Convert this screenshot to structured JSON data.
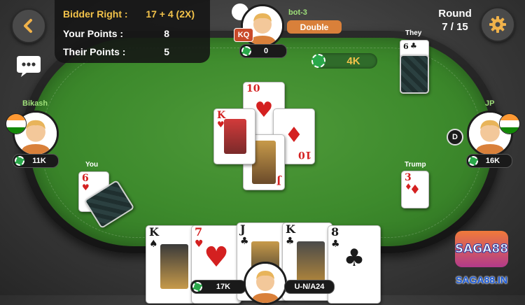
{
  "score": {
    "bidder_label": "Bidder Right :",
    "bidder_value": "17 + 4 (2X)",
    "your_label": "Your Points :",
    "your_value": "8",
    "their_label": "Their Points :",
    "their_value": "5"
  },
  "round": {
    "label": "Round",
    "value": "7 / 15"
  },
  "top_player": {
    "name": "bot-3",
    "badge": "KQ",
    "action": "Double",
    "coins": "0"
  },
  "pot": {
    "value": "4K"
  },
  "left_player": {
    "name": "Bikash",
    "coins": "11K"
  },
  "right_player": {
    "name": "JP",
    "coins": "16K",
    "dealer": "D"
  },
  "me": {
    "label": "You",
    "coins": "17K",
    "id": "U-N/A24"
  },
  "labels": {
    "they": "They",
    "trump": "Trump"
  },
  "center_cards": [
    {
      "rank": "10",
      "suit": "♥",
      "color": "red"
    },
    {
      "rank": "K",
      "suit": "♥",
      "color": "red"
    },
    {
      "rank": "10",
      "suit": "♦",
      "color": "red"
    },
    {
      "rank": "J",
      "suit": "♦",
      "color": "red"
    }
  ],
  "they_card": {
    "rank": "6",
    "suit": "♣"
  },
  "you_card": {
    "rank": "6",
    "suit": "♥"
  },
  "trump_card": {
    "rank": "3",
    "suit": "♦"
  },
  "hand": [
    {
      "rank": "K",
      "suit": "♠",
      "color": "blk"
    },
    {
      "rank": "7",
      "suit": "♥",
      "color": "red"
    },
    {
      "rank": "J",
      "suit": "♣",
      "color": "blk"
    },
    {
      "rank": "K",
      "suit": "♣",
      "color": "blk"
    },
    {
      "rank": "8",
      "suit": "♣",
      "color": "blk"
    }
  ],
  "brand": {
    "logo_text": "SAGA88",
    "site": "SAGA88.IN"
  },
  "colors": {
    "accent_orange": "#d9803a",
    "felt": "#3d8a2c",
    "player_name": "#9fe07a"
  }
}
